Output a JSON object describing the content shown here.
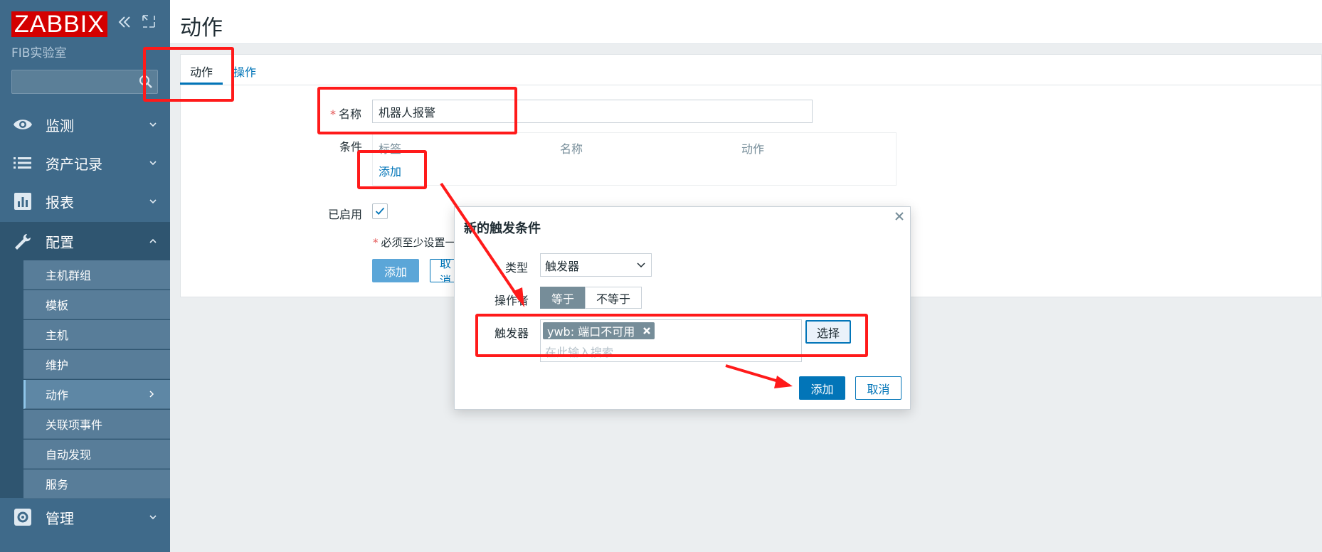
{
  "sidebar": {
    "logo": "ZABBIX",
    "org": "FIB实验室",
    "search_placeholder": "",
    "nav": {
      "monitoring": "监测",
      "inventory": "资产记录",
      "reports": "报表",
      "configuration": "配置",
      "administration": "管理"
    },
    "config_items": [
      "主机群组",
      "模板",
      "主机",
      "维护",
      "动作",
      "关联项事件",
      "自动发现",
      "服务"
    ]
  },
  "header": {
    "title": "动作"
  },
  "tabs": {
    "action": "动作",
    "operations": "操作"
  },
  "form": {
    "name_label": "名称",
    "name_value": "机器人报警",
    "conditions_label": "条件",
    "cond_col_label": "标签",
    "cond_col_name": "名称",
    "cond_col_action": "动作",
    "add_link": "添加",
    "enabled_label": "已启用",
    "note": "必须至少设置一",
    "add_button": "添加",
    "cancel_button": "取消"
  },
  "dialog": {
    "title": "新的触发条件",
    "type_label": "类型",
    "type_value": "触发器",
    "operator_label": "操作者",
    "operator_equal": "等于",
    "operator_not_equal": "不等于",
    "trigger_label": "触发器",
    "trigger_chip": "ywb: 端口不可用",
    "trigger_placeholder": "在此输入搜索",
    "select_button": "选择",
    "add_button": "添加",
    "cancel_button": "取消"
  },
  "colors": {
    "sidebar": "#3f6a8a",
    "accent": "#0275b8",
    "logo_red": "#d40000",
    "annotation_red": "#ff1a1a"
  }
}
